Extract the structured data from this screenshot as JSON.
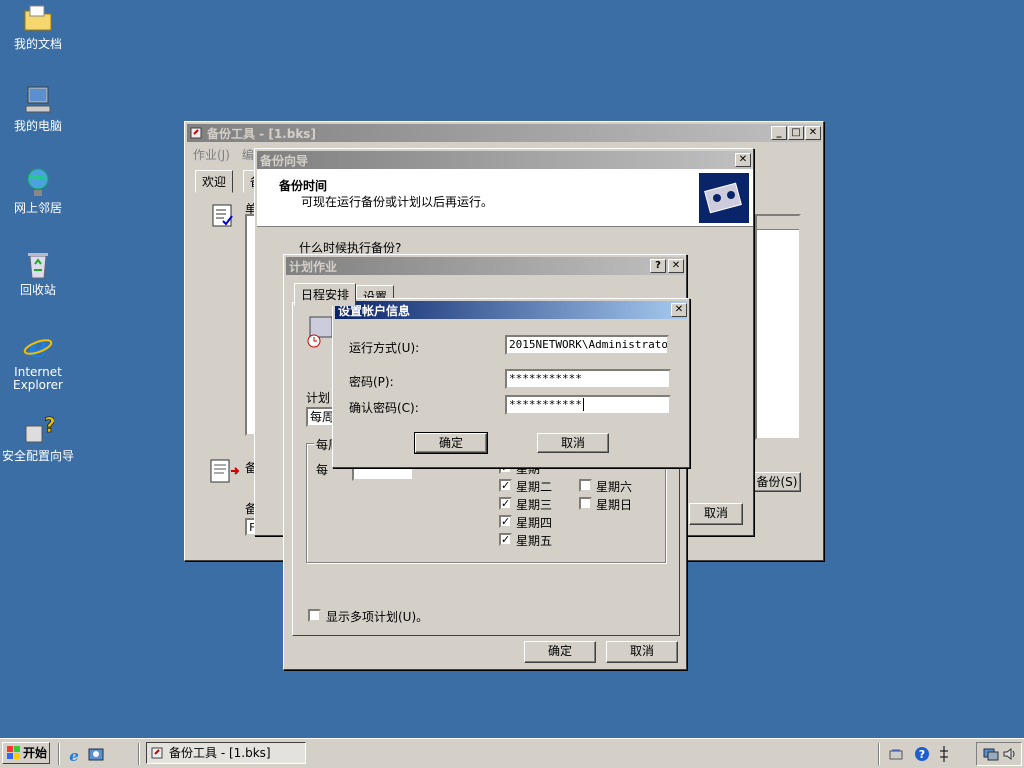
{
  "desktop": {
    "icons": [
      {
        "label": "我的文档"
      },
      {
        "label": "我的电脑"
      },
      {
        "label": "网上邻居"
      },
      {
        "label": "回收站"
      },
      {
        "label_line1": "Internet",
        "label_line2": "Explorer"
      },
      {
        "label": "安全配置向导"
      }
    ]
  },
  "backup_window": {
    "title": "备份工具 - [1.bks]",
    "menu": [
      "作业(J)",
      "编"
    ],
    "tabs": [
      "欢迎",
      "备"
    ],
    "clipped_label_1": "单",
    "clipped_label_2": "备",
    "clipped_label_3": "备",
    "clipped_field": "F",
    "start_backup_button": "备份(S)"
  },
  "wizard": {
    "title": "备份向导",
    "header_title": "备份时间",
    "header_sub": "可现在运行备份或计划以后再运行。",
    "question": "什么时候执行备份?",
    "cancel_button": "取消"
  },
  "schedule": {
    "title": "计划作业",
    "help_button": "?",
    "tabs": [
      "日程安排",
      "设置"
    ],
    "label_plan": "计划",
    "plan_value": "每周",
    "group_label": "每周",
    "every_label": "每",
    "weekdays_left": [
      {
        "label": "星期一",
        "checked": true
      },
      {
        "label": "星期二",
        "checked": true
      },
      {
        "label": "星期三",
        "checked": true
      },
      {
        "label": "星期四",
        "checked": true
      },
      {
        "label": "星期五",
        "checked": true
      }
    ],
    "weekdays_right": [
      {
        "label": "星期六",
        "checked": false
      },
      {
        "label": "星期日",
        "checked": false
      }
    ],
    "show_multiple_label": "显示多项计划(U)。",
    "ok_button": "确定",
    "cancel_button": "取消"
  },
  "account_dialog": {
    "title": "设置帐户信息",
    "run_as_label": "运行方式(U):",
    "run_as_value": "2015NETWORK\\Administrator",
    "password_label": "密码(P):",
    "password_value": "***********",
    "confirm_label": "确认密码(C):",
    "confirm_value": "***********",
    "ok_button": "确定",
    "cancel_button": "取消"
  },
  "taskbar": {
    "start_label": "开始",
    "task_label": "备份工具 - [1.bks]"
  }
}
